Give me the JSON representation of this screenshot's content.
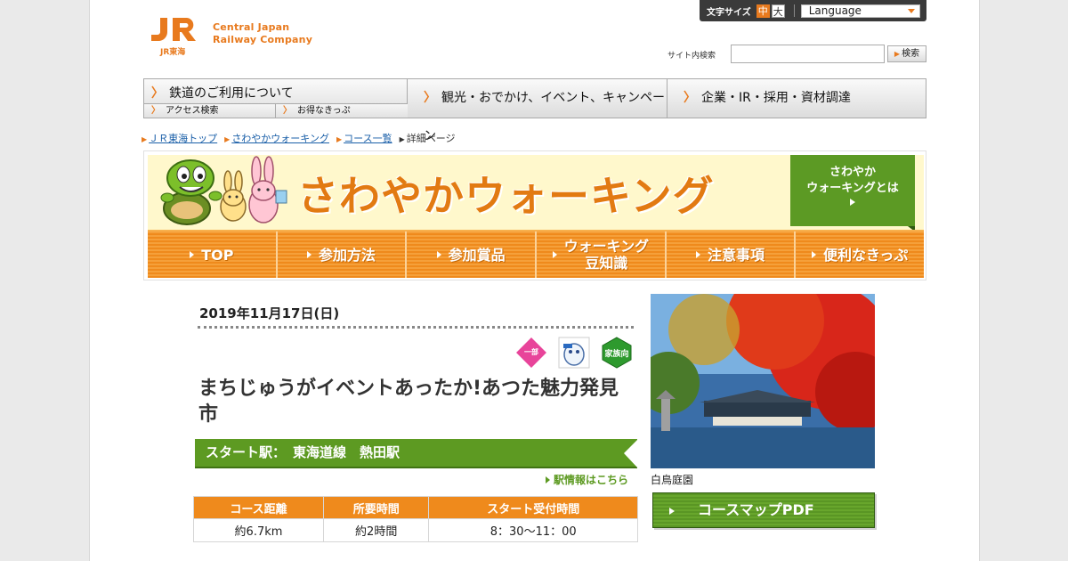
{
  "header": {
    "font_size_label": "文字サイズ",
    "font_size_medium": "中",
    "font_size_large": "大",
    "language_label": "Language",
    "logo_line1": "Central Japan",
    "logo_line2": "Railway Company",
    "logo_sub": "JR東海",
    "site_search_label": "サイト内検索",
    "search_value": "",
    "search_button": "検索"
  },
  "global_nav": {
    "railway": "鉄道のご利用について",
    "access_search": "アクセス検索",
    "deals": "お得なきっぷ",
    "tourism": "観光・おでかけ、イベント、キャンペーン",
    "corporate": "企業・IR・採用・資材調達"
  },
  "breadcrumb": [
    "ＪＲ東海トップ",
    "さわやかウォーキング",
    "コース一覧",
    "詳細ページ"
  ],
  "banner": {
    "title": "さわやかウォーキング",
    "about_line1": "さわやか",
    "about_line2": "ウォーキングとは",
    "nav": [
      {
        "label": "TOP"
      },
      {
        "label": "参加方法"
      },
      {
        "label": "参加賞品"
      },
      {
        "label": "ウォーキング\n豆知識"
      },
      {
        "label": "注意事項"
      },
      {
        "label": "便利なきっぷ"
      }
    ]
  },
  "course": {
    "date": "2019年11月17日(日)",
    "badge_text": "家族向",
    "badge_ichibu": "一部",
    "title": "まちじゅうがイベントあったか!あつた魅力発見市",
    "start_label": "スタート駅：",
    "start_station": "東海道線　熱田駅",
    "station_link": "駅情報はこちら",
    "table_headers": [
      "コース距離",
      "所要時間",
      "スタート受付時間"
    ],
    "table_values": [
      "約6.7km",
      "約2時間",
      "8：30～11：00"
    ]
  },
  "side": {
    "photo_caption": "白鳥庭園",
    "map_pdf_button": "コースマップPDF"
  },
  "colors": {
    "orange": "#ef8a1c",
    "green": "#5d9a22",
    "link_blue": "#1a5fa8"
  }
}
